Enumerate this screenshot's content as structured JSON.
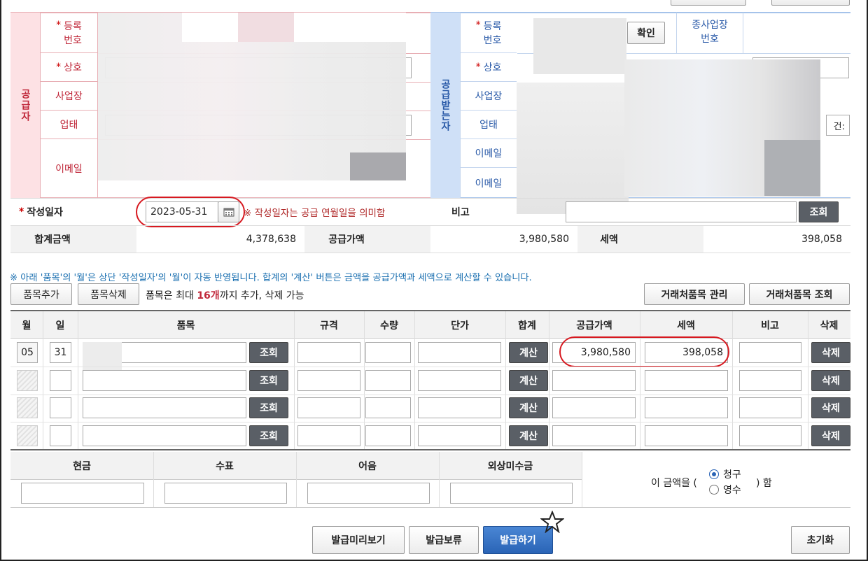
{
  "supplier": {
    "side_label": "공급자",
    "reg_label": "등록\n번호",
    "name_label": "상호",
    "addr_label": "사업장",
    "biz_label": "업태",
    "email_label": "이메일"
  },
  "receiver": {
    "side_label": "공급받는자",
    "reg_label": "등록\n번호",
    "confirm_button": "확인",
    "branch_label": "종사업장\n번호",
    "name_label": "상호",
    "addr_label": "사업장",
    "biz_label": "업태",
    "email1_label": "이메일",
    "email2_label": "이메일",
    "item_partial": "건:"
  },
  "date_row": {
    "label": "작성일자",
    "value": "2023-05-31",
    "note": "※ 작성일자는 공급 연월일을 의미함",
    "remarks_label": "비고",
    "lookup_button": "조회"
  },
  "totals": {
    "total_label": "합계금액",
    "total_value": "4,378,638",
    "supply_label": "공급가액",
    "supply_value": "3,980,580",
    "tax_label": "세액",
    "tax_value": "398,058"
  },
  "items_notice": "※ 아래 '품목'의 '월'은 상단 '작성일자'의 '월'이 자동 반영됩니다. 합계의 '계산' 버튼은 금액을 공급가액과 세액으로 계산할 수 있습니다.",
  "item_toolbar": {
    "add": "품목추가",
    "delete": "품목삭제",
    "limit_prefix": "품목은 최대 ",
    "limit_count": "16개",
    "limit_suffix": "까지 추가, 삭제 가능",
    "manage": "거래처품목 관리",
    "lookup": "거래처품목 조회"
  },
  "columns": [
    "월",
    "일",
    "품목",
    "규격",
    "수량",
    "단가",
    "합계",
    "공급가액",
    "세액",
    "비고",
    "삭제"
  ],
  "rows": [
    {
      "month": "05",
      "day": "31",
      "lookup": "조회",
      "calc": "계산",
      "supply": "3,980,580",
      "tax": "398,058",
      "del": "삭제"
    },
    {
      "month": "",
      "day": "",
      "lookup": "조회",
      "calc": "계산",
      "supply": "",
      "tax": "",
      "del": "삭제"
    },
    {
      "month": "",
      "day": "",
      "lookup": "조회",
      "calc": "계산",
      "supply": "",
      "tax": "",
      "del": "삭제"
    },
    {
      "month": "",
      "day": "",
      "lookup": "조회",
      "calc": "계산",
      "supply": "",
      "tax": "",
      "del": "삭제"
    }
  ],
  "payment": {
    "cash": "현금",
    "check": "수표",
    "note": "어음",
    "credit": "외상미수금",
    "sentence_prefix": "이 금액을 (",
    "opt_claim": "청구",
    "opt_receipt": "영수",
    "sentence_suffix": ") 함"
  },
  "actions": {
    "preview": "발급미리보기",
    "hold": "발급보류",
    "issue": "발급하기",
    "reset": "초기화"
  },
  "colors": {
    "supplier_side": "#fde1e4",
    "supplier_text": "#c0283a",
    "receiver_side": "#cfe0f7",
    "receiver_text": "#2a5aa8",
    "highlight_oval": "#d71920"
  }
}
